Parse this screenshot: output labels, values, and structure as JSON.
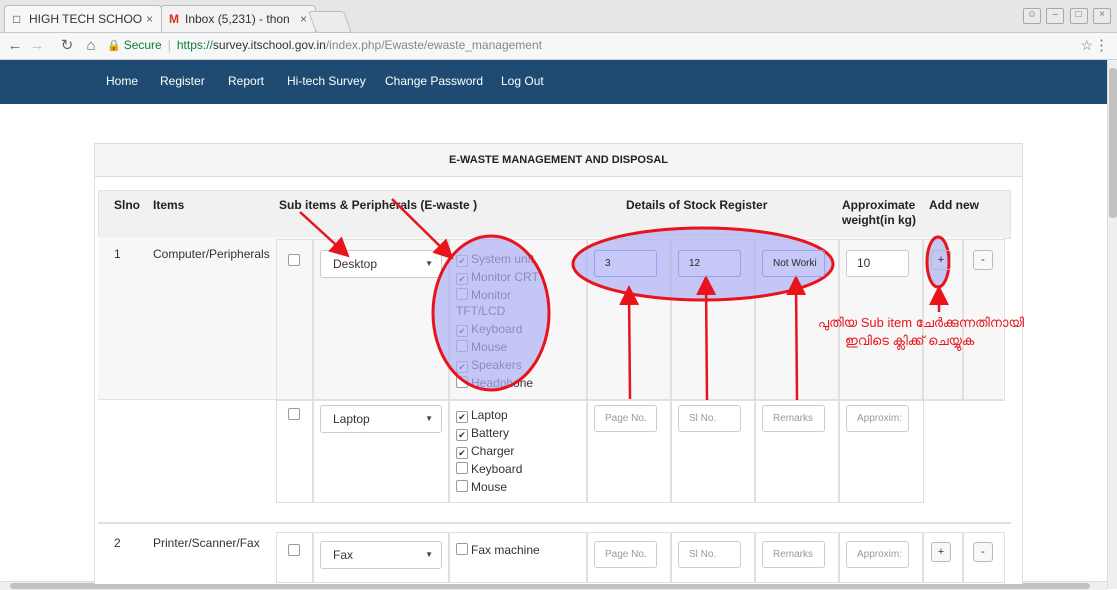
{
  "browser": {
    "tabs": [
      {
        "title": "HIGH TECH SCHOO",
        "close": "×"
      },
      {
        "title": "Inbox (5,231) - thon",
        "close": "×"
      }
    ],
    "url": {
      "secure_label": "Secure",
      "scheme": "https://",
      "host": "survey.itschool.gov.in",
      "path": "/index.php/Ewaste/ewaste_management"
    }
  },
  "nav": [
    "Home",
    "Register",
    "Report",
    "Hi-tech Survey",
    "Change Password",
    "Log Out"
  ],
  "panel_title": "E-WASTE MANAGEMENT AND DISPOSAL",
  "headers": {
    "slno": "Slno",
    "items": "Items",
    "sub": "Sub items & Peripherals (E-waste )",
    "stock": "Details of Stock Register",
    "weight_1": "Approximate",
    "weight_2": "weight(in kg)",
    "addnew": "Add new"
  },
  "rows": [
    {
      "slno": "1",
      "item": "Computer/Peripherals",
      "sub": [
        {
          "selected": "Desktop",
          "checked": false,
          "parts": [
            {
              "label": "System unit",
              "checked": true
            },
            {
              "label": "Monitor CRT",
              "checked": true
            },
            {
              "label": "Monitor",
              "checked": false
            },
            {
              "label": "TFT/LCD",
              "checked": false
            },
            {
              "label": "Keyboard",
              "checked": true
            },
            {
              "label": "Mouse",
              "checked": false
            },
            {
              "label": "Speakers",
              "checked": true
            },
            {
              "label": "Headphone",
              "checked": false
            }
          ],
          "page_no": "3",
          "sl_no": "12",
          "remarks": "Not Worki",
          "weight": "10"
        },
        {
          "selected": "Laptop",
          "checked": false,
          "parts": [
            {
              "label": "Laptop",
              "checked": true
            },
            {
              "label": "Battery",
              "checked": true
            },
            {
              "label": "Charger",
              "checked": true
            },
            {
              "label": "Keyboard",
              "checked": false
            },
            {
              "label": "Mouse",
              "checked": false
            }
          ],
          "page_no_ph": "Page No.",
          "sl_no_ph": "Sl No.",
          "remarks_ph": "Remarks",
          "weight_ph": "Approxim:"
        }
      ]
    },
    {
      "slno": "2",
      "item": "Printer/Scanner/Fax",
      "sub": [
        {
          "selected": "Fax",
          "checked": false,
          "parts": [
            {
              "label": "Fax machine",
              "checked": false
            }
          ],
          "page_no_ph": "Page No.",
          "sl_no_ph": "Sl No.",
          "remarks_ph": "Remarks",
          "weight_ph": "Approxim:"
        }
      ]
    }
  ],
  "buttons": {
    "add": "+",
    "remove": "-"
  },
  "annotation": {
    "line1": "പുതിയ Sub item ചേർക്കുന്നതിനായി",
    "line2": "ഇവിടെ ക്ലിക്ക് ചെയ്യുക",
    "color": "#e8131b",
    "fill": "#aeb0f4"
  }
}
